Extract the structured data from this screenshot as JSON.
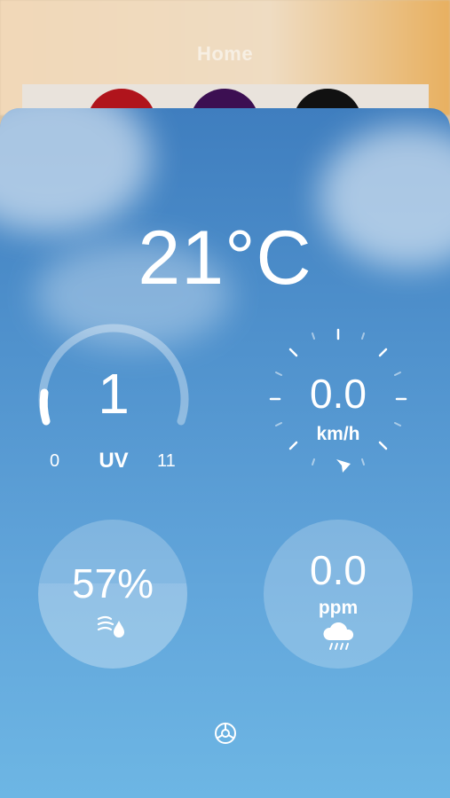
{
  "background_page": {
    "title": "Home",
    "dot_colors": [
      "#b0141c",
      "#3c0f52",
      "#111111"
    ]
  },
  "weather": {
    "temperature": "21°C",
    "uv": {
      "value": "1",
      "min": "0",
      "label": "UV",
      "max": "11",
      "level_fraction": 0.09
    },
    "wind": {
      "speed": "0.0",
      "unit": "km/h",
      "direction_icon": "navigation-arrow-icon"
    },
    "humidity": {
      "value": "57%",
      "fill_fraction": 0.57,
      "icon": "humidity-icon"
    },
    "rain": {
      "value": "0.0",
      "unit": "ppm",
      "icon": "rain-cloud-icon"
    },
    "settings_icon": "gear-icon"
  },
  "colors": {
    "sky_top": "#3f7ebf",
    "sky_bottom": "#6db6e4",
    "text": "#ffffff"
  }
}
